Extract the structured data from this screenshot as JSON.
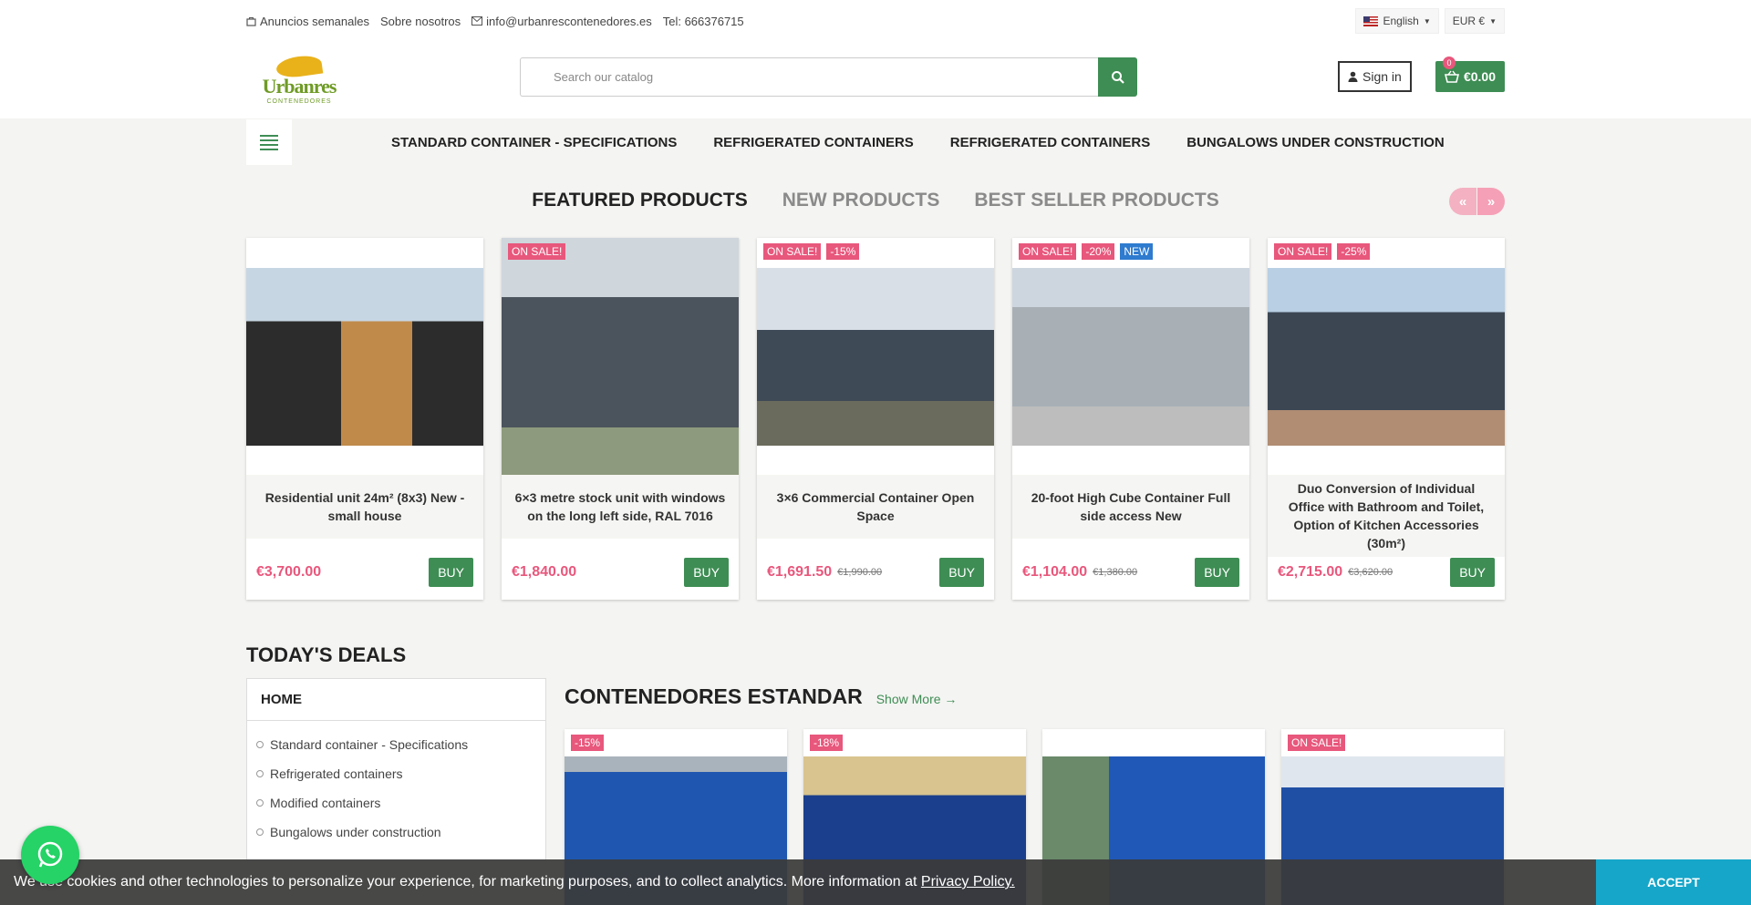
{
  "topbar": {
    "ads": "Anuncios semanales",
    "about": "Sobre nosotros",
    "email": "info@urbanrescontenedores.es",
    "phone": "Tel: 666376715",
    "language": "English",
    "currency": "EUR €"
  },
  "header": {
    "logo_name": "Urbanres",
    "logo_sub": "CONTENEDORES",
    "search_placeholder": "Search our catalog",
    "signin": "Sign in",
    "cart_total": "€0.00",
    "cart_count": "0"
  },
  "nav": {
    "items": [
      "STANDARD CONTAINER - SPECIFICATIONS",
      "REFRIGERATED CONTAINERS",
      "REFRIGERATED CONTAINERS",
      "BUNGALOWS UNDER CONSTRUCTION"
    ]
  },
  "tabs": [
    "FEATURED PRODUCTS",
    "NEW PRODUCTS",
    "BEST SELLER PRODUCTS"
  ],
  "products": [
    {
      "title": "Residential unit 24m² (8x3) New - small house",
      "price": "€3,700.00",
      "old": "",
      "flags": [],
      "buy": "BUY"
    },
    {
      "title": "6×3 metre stock unit with windows on the long left side, RAL 7016",
      "price": "€1,840.00",
      "old": "",
      "flags": [
        "ON SALE!"
      ],
      "buy": "BUY"
    },
    {
      "title": "3×6 Commercial Container Open Space",
      "price": "€1,691.50",
      "old": "€1,990.00",
      "flags": [
        "ON SALE!",
        "-15%"
      ],
      "buy": "BUY"
    },
    {
      "title": "20-foot High Cube Container Full side access New",
      "price": "€1,104.00",
      "old": "€1,380.00",
      "flags": [
        "ON SALE!",
        "-20%",
        "NEW"
      ],
      "buy": "BUY"
    },
    {
      "title": "Duo Conversion of Individual Office with Bathroom and Toilet, Option of Kitchen Accessories (30m²)",
      "price": "€2,715.00",
      "old": "€3,620.00",
      "flags": [
        "ON SALE!",
        "-25%"
      ],
      "buy": "BUY"
    }
  ],
  "deals": {
    "title": "TODAY'S DEALS",
    "side_home": "HOME",
    "side_items": [
      "Standard container - Specifications",
      "Refrigerated containers",
      "Modified containers",
      "Bungalows under construction"
    ],
    "section_title": "CONTENEDORES ESTANDAR",
    "show_more": "Show More",
    "mini_flags": [
      "-15%",
      "-18%",
      "",
      "ON SALE!"
    ]
  },
  "cookie": {
    "text": "We use cookies and other technologies to personalize your experience, for marketing purposes, and to collect analytics. More information at",
    "link": "Privacy Policy.",
    "accept": "ACCEPT"
  },
  "colors": {
    "accent": "#3e8d54",
    "sale": "#e8577c",
    "new": "#2e7bcf",
    "cookie_accept": "#16a6c9"
  }
}
